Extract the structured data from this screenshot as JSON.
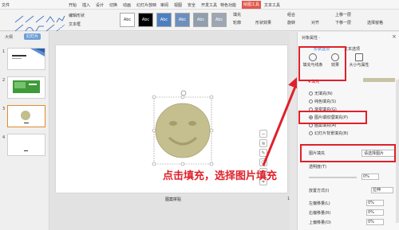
{
  "menu": {
    "file": "文件",
    "items": [
      "开始",
      "插入",
      "设计",
      "切换",
      "动画",
      "幻灯片放映",
      "审阅",
      "视图",
      "安全",
      "开发工具",
      "特色功能"
    ],
    "drawing_tools": "绘图工具",
    "text_tools": "文本工具"
  },
  "ribbon": {
    "edit_shape": "编辑形状",
    "text_box": "文本框",
    "shape_fill": "填充",
    "outline": "轮廓",
    "shape_effect": "形状效果",
    "group": "组合",
    "rotate": "旋转",
    "align": "对齐",
    "up_one": "上移一层",
    "down_one": "下移一层",
    "select_pane": "选择窗格",
    "style_labels": [
      "Abc",
      "Abc",
      "Abc",
      "Abc",
      "Abc",
      "Abc"
    ],
    "style_colors": [
      "#ffffff",
      "#000000",
      "#4c7fbf",
      "#6d8fbe",
      "#8f9fae",
      "#9ea6b4"
    ]
  },
  "left_panel": {
    "tabs": [
      "大纲",
      "幻灯片"
    ],
    "slide_numbers": [
      "1",
      "2",
      "3",
      "4"
    ]
  },
  "slide": {
    "caption": "图案拼贴",
    "number": "1"
  },
  "annotation": "点击填充，选择图片填充",
  "right_panel": {
    "title": "对象属性 ·",
    "tabs": [
      "形状选项",
      "文本选项"
    ],
    "icon_tabs": [
      "填充与线条",
      "效果",
      "大小与属性"
    ],
    "section": "◂ 填充",
    "options": [
      "无填充(N)",
      "纯色填充(S)",
      "渐变填充(G)",
      "图片或纹理填充(P)",
      "图案填充(A)",
      "幻灯片背景填充(B)"
    ],
    "selected_option": 3,
    "picture_fill_label": "图片填充",
    "picture_fill_value": "请选择图片",
    "transparency_label": "透明度(T)",
    "transparency_value": "0%",
    "tile_label": "放置方式(I)",
    "tile_value": "拉伸",
    "offset_left": "左偏移量(L)",
    "offset_right": "右偏移量(R)",
    "offset_top": "上偏移量(O)",
    "offset_value": "0%"
  }
}
